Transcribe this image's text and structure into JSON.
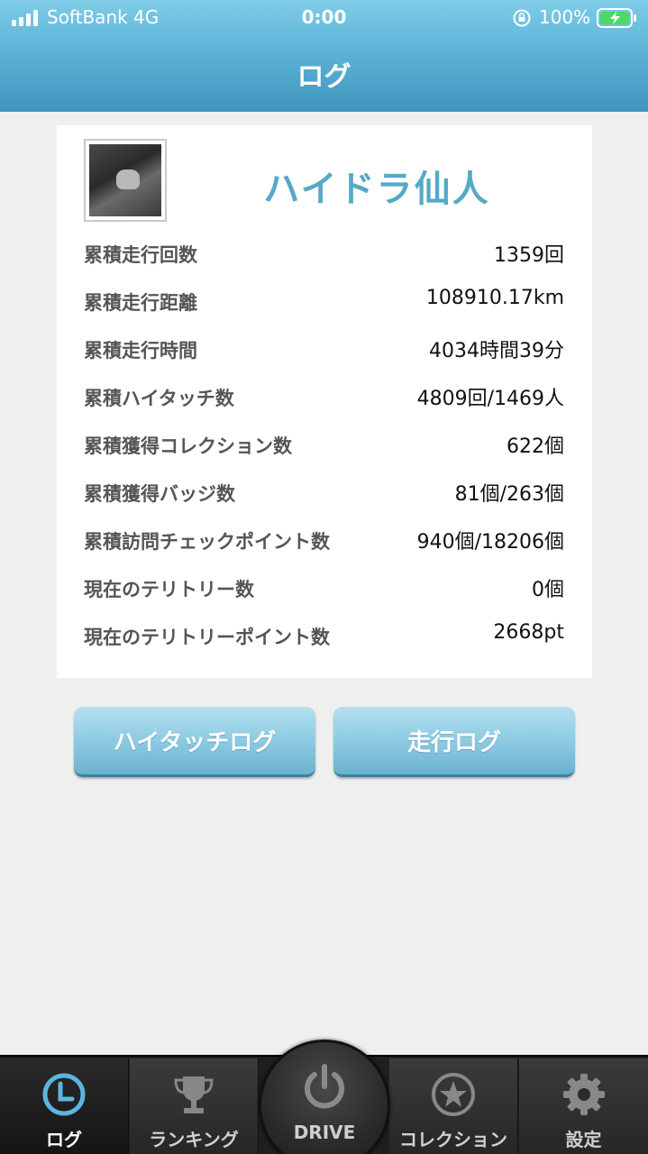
{
  "status_bar": {
    "carrier": "SoftBank   4G",
    "time": "0:00",
    "battery_percent": "100%"
  },
  "header": {
    "title": "ログ"
  },
  "profile": {
    "name": "ハイドラ仙人",
    "avatar_icon": "user-photo"
  },
  "stats": [
    {
      "label": "累積走行回数",
      "value": "1359回"
    },
    {
      "label": "累積走行距離",
      "value": "108910.17km"
    },
    {
      "label": "累積走行時間",
      "value": "4034時間39分"
    },
    {
      "label": "累積ハイタッチ数",
      "value": "4809回/1469人"
    },
    {
      "label": "累積獲得コレクション数",
      "value": "622個"
    },
    {
      "label": "累積獲得バッジ数",
      "value": "81個/263個"
    },
    {
      "label": "累積訪問チェックポイント数",
      "value": "940個/18206個"
    },
    {
      "label": "現在のテリトリー数",
      "value": "0個"
    },
    {
      "label": "現在のテリトリーポイント数",
      "value": "2668pt"
    }
  ],
  "buttons": {
    "hitouch_log": "ハイタッチログ",
    "drive_log": "走行ログ"
  },
  "tabbar": {
    "log": "ログ",
    "ranking": "ランキング",
    "drive": "DRIVE",
    "collection": "コレクション",
    "settings": "設定"
  },
  "colors": {
    "accent": "#56a8c6",
    "header_top": "#7fcde8",
    "header_bottom": "#3f95bd",
    "tab_active_icon": "#5bb6e0",
    "tabbar_bg": "#1f1f1f"
  }
}
